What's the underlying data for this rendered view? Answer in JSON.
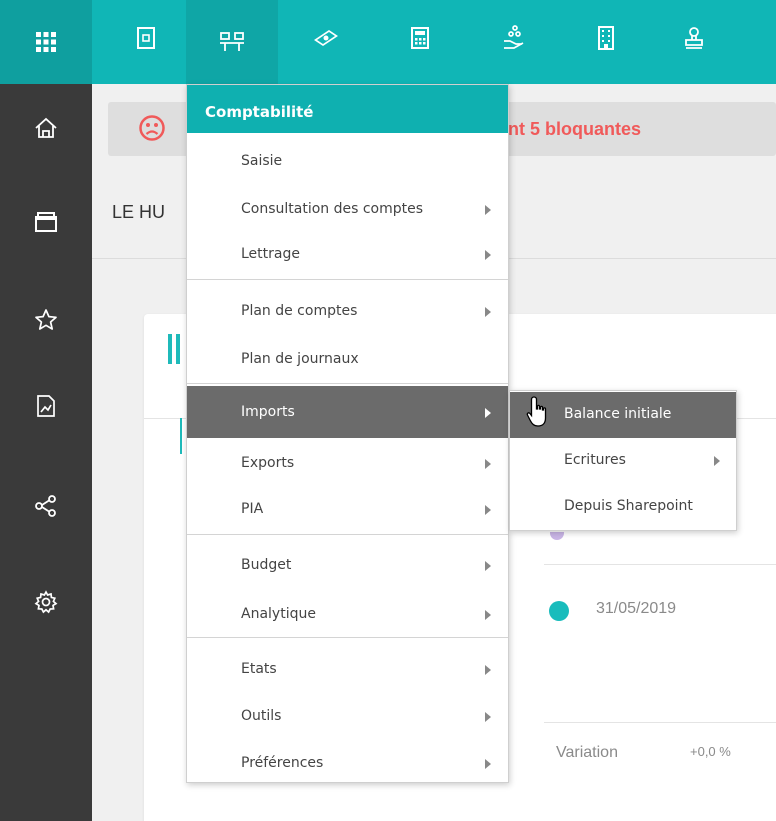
{
  "colors": {
    "accent": "#10b6b6",
    "sidebar": "#3a3a3a",
    "menu_selected": "#6b6b6b",
    "alert_text": "#f05a5a"
  },
  "topbar": {
    "icons": [
      "apps-grid-icon",
      "document-icon",
      "org-chart-icon",
      "money-icon",
      "calculator-icon",
      "hand-coins-icon",
      "building-icon",
      "stamp-icon"
    ]
  },
  "sidebar": {
    "icons": [
      "home-icon",
      "windows-icon",
      "star-icon",
      "report-chart-icon",
      "share-icon",
      "settings-icon"
    ]
  },
  "main": {
    "alert_text": "nt 5 bloquantes",
    "company_name": "LE HU",
    "date": "31/05/2019",
    "variation_label": "Variation",
    "variation_value": "+0,0 %"
  },
  "menu": {
    "header": "Comptabilité",
    "items": [
      {
        "label": "Saisie"
      },
      {
        "label": "Consultation des comptes"
      },
      {
        "label": "Lettrage"
      },
      {
        "label": "Plan de comptes"
      },
      {
        "label": "Plan de journaux"
      },
      {
        "label": "Imports"
      },
      {
        "label": "Exports"
      },
      {
        "label": "PIA"
      },
      {
        "label": "Budget"
      },
      {
        "label": "Analytique"
      },
      {
        "label": "Etats"
      },
      {
        "label": "Outils"
      },
      {
        "label": "Préférences"
      }
    ]
  },
  "submenu": {
    "items": [
      {
        "label": "Balance initiale"
      },
      {
        "label": "Ecritures"
      },
      {
        "label": "Depuis Sharepoint"
      }
    ]
  }
}
